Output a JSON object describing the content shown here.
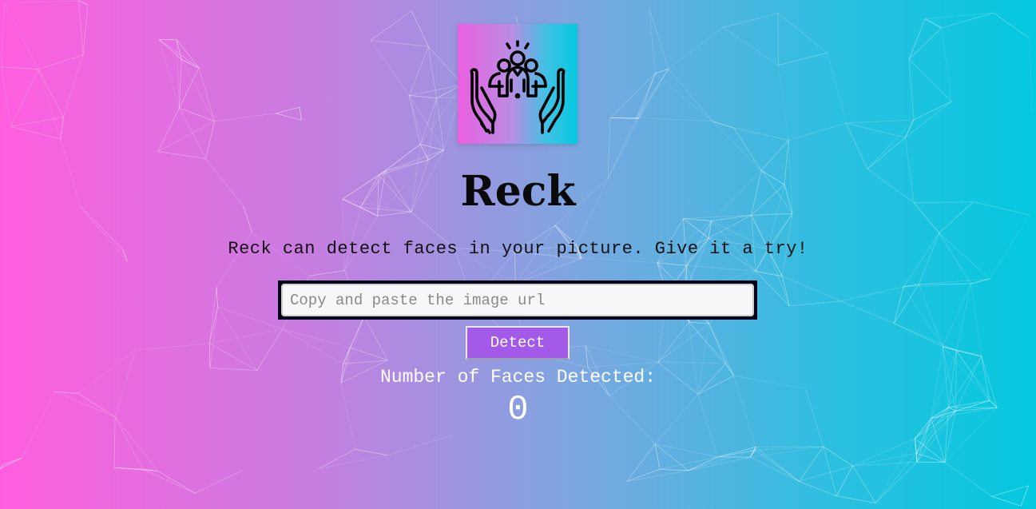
{
  "app": {
    "title": "Reck",
    "tagline": "Reck can detect faces in your picture. Give it a try!",
    "logo_icon": "hands-holding-people-icon"
  },
  "search": {
    "placeholder": "Copy and paste the image url",
    "value": ""
  },
  "actions": {
    "detect_label": "Detect"
  },
  "result": {
    "label": "Number of Faces Detected:",
    "count": "0"
  },
  "colors": {
    "gradient_left": "#ff5edf",
    "gradient_right": "#04c8de",
    "button": "#a45ae8",
    "input_frame": "#060018"
  }
}
